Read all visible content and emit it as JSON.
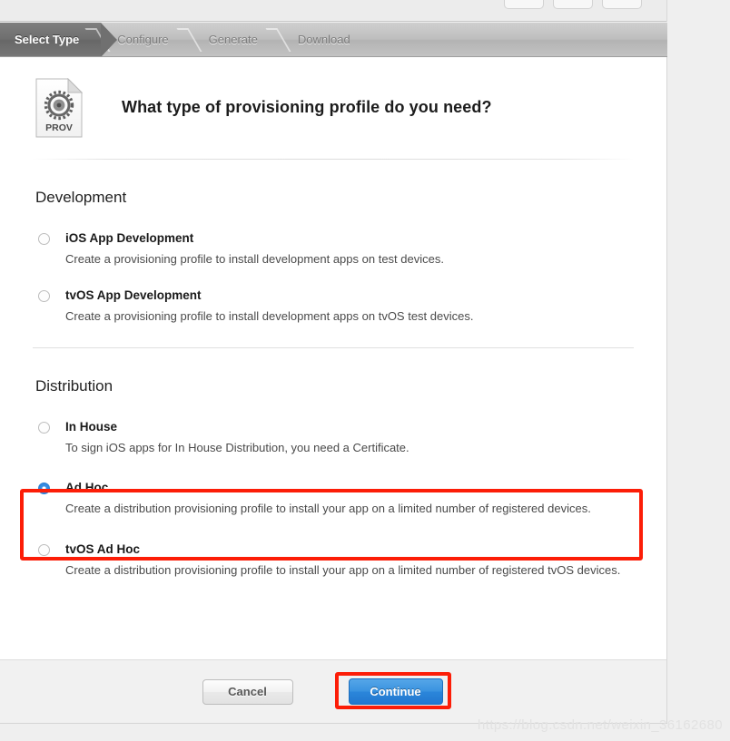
{
  "window": {
    "ghost_buttons": [
      "",
      "",
      ""
    ]
  },
  "steps": [
    {
      "label": "Select Type",
      "active": true
    },
    {
      "label": "Configure",
      "active": false
    },
    {
      "label": "Generate",
      "active": false
    },
    {
      "label": "Download",
      "active": false
    }
  ],
  "header": {
    "icon_label": "PROV",
    "title": "What type of provisioning profile do you need?"
  },
  "sections": [
    {
      "title": "Development",
      "options": [
        {
          "label": "iOS App Development",
          "description": "Create a provisioning profile to install development apps on test devices.",
          "selected": false
        },
        {
          "label": "tvOS App Development",
          "description": "Create a provisioning profile to install development apps on tvOS test devices.",
          "selected": false
        }
      ]
    },
    {
      "title": "Distribution",
      "options": [
        {
          "label": "In House",
          "description": "To sign iOS apps for In House Distribution, you need a Certificate.",
          "selected": false
        },
        {
          "label": "Ad Hoc",
          "description": "Create a distribution provisioning profile to install your app on a limited number of registered devices.",
          "selected": true
        },
        {
          "label": "tvOS Ad Hoc",
          "description": "Create a distribution provisioning profile to install your app on a limited number of registered tvOS devices.",
          "selected": false
        }
      ]
    }
  ],
  "footer": {
    "cancel_label": "Cancel",
    "continue_label": "Continue"
  },
  "annotation": {
    "highlight_color": "#fc1d07"
  },
  "watermark": {
    "text": "https://blog.csdn.net/weixin_36162680"
  }
}
